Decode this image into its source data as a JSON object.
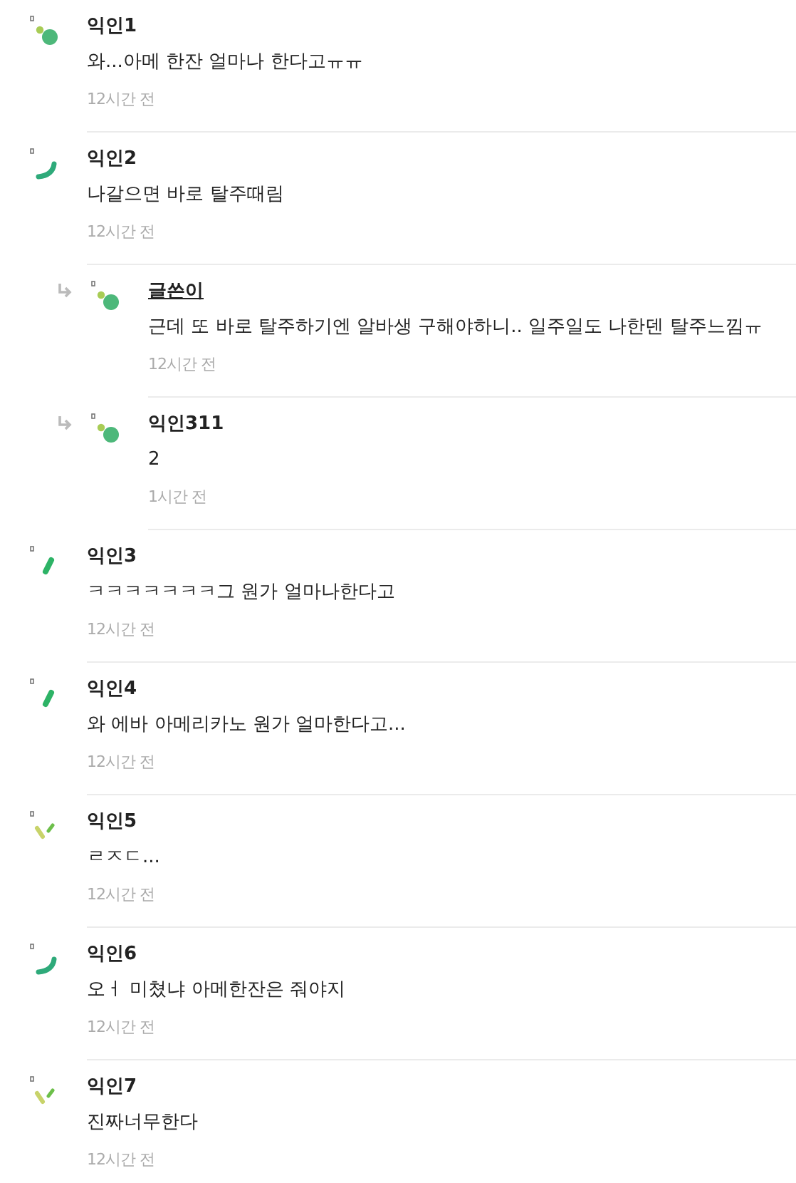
{
  "comments": [
    {
      "author": "익인1",
      "writer": false,
      "avatar": {
        "kind": "dots"
      },
      "text": "와...아메 한잔 얼마나 한다고ㅠㅠ",
      "time": "12시간 전"
    },
    {
      "author": "익인2",
      "writer": false,
      "avatar": {
        "kind": "arc"
      },
      "text": "나갈으면 바로 탈주때림",
      "time": "12시간 전",
      "children": [
        {
          "author": "글쓴이",
          "writer": true,
          "avatar": {
            "kind": "dots"
          },
          "text": "근데 또 바로 탈주하기엔 알바생 구해야하니.. 일주일도 나한덴 탈주느낌ㅠ",
          "time": "12시간 전"
        },
        {
          "author": "익인311",
          "writer": false,
          "avatar": {
            "kind": "dots"
          },
          "text": "2",
          "time": "1시간 전"
        }
      ]
    },
    {
      "author": "익인3",
      "writer": false,
      "avatar": {
        "kind": "bar"
      },
      "text": "ㅋㅋㅋㅋㅋㅋㅋ그 원가 얼마나한다고",
      "time": "12시간 전"
    },
    {
      "author": "익인4",
      "writer": false,
      "avatar": {
        "kind": "bar"
      },
      "text": "와 에바 아메리카노 원가 얼마한다고...",
      "time": "12시간 전"
    },
    {
      "author": "익인5",
      "writer": false,
      "avatar": {
        "kind": "ticks"
      },
      "text": "ㄹㅈㄷ...",
      "time": "12시간 전"
    },
    {
      "author": "익인6",
      "writer": false,
      "avatar": {
        "kind": "arc"
      },
      "text": "오ㅓ  미쳤냐 아메한잔은 줘야지",
      "time": "12시간 전"
    },
    {
      "author": "익인7",
      "writer": false,
      "avatar": {
        "kind": "ticks"
      },
      "text": "진짜너무한다",
      "time": "12시간 전"
    }
  ]
}
